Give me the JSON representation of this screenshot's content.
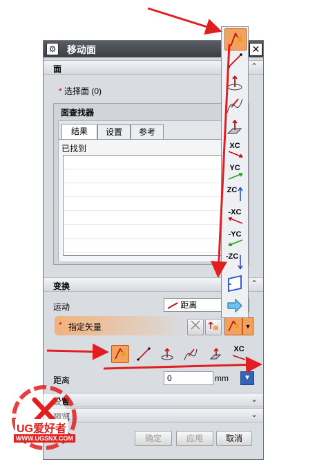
{
  "dialog": {
    "title": "移动面",
    "close_glyph": "✕",
    "face_section": {
      "header": "面",
      "select_label": "选择面 (0)",
      "required_mark": "*"
    },
    "face_finder": {
      "header": "面查找器",
      "tabs": [
        "结果",
        "设置",
        "参考"
      ],
      "found_label": "已找到"
    },
    "transform_section": {
      "header": "变换",
      "motion_label": "运动",
      "motion_value": "距离",
      "vector_label": "指定矢量",
      "distance_label": "距离",
      "distance_value": "0",
      "distance_unit": "mm",
      "vector_toolbar": [
        {
          "icon": "auto-vector-icon",
          "label": ""
        },
        {
          "icon": "two-points-icon",
          "label": ""
        },
        {
          "icon": "angle-vector-icon",
          "label": ""
        },
        {
          "icon": "curve-tangent-icon",
          "label": ""
        },
        {
          "icon": "face-normal-icon",
          "label": ""
        },
        {
          "icon": "xc-axis-icon",
          "label": "XC"
        }
      ]
    },
    "settings_header": "设置",
    "preview_header": "预览",
    "buttons": {
      "ok": "确定",
      "apply": "应用",
      "cancel": "取消"
    }
  },
  "vector_palette": {
    "items": [
      {
        "icon": "auto-vector-icon",
        "label": ""
      },
      {
        "icon": "two-points-icon",
        "label": ""
      },
      {
        "icon": "angle-vector-icon",
        "label": ""
      },
      {
        "icon": "curve-tangent-icon",
        "label": ""
      },
      {
        "icon": "face-normal-icon",
        "label": ""
      },
      {
        "icon": "xc-axis-icon",
        "label": "XC"
      },
      {
        "icon": "yc-axis-icon",
        "label": "YC"
      },
      {
        "icon": "zc-axis-icon",
        "label": "ZC"
      },
      {
        "icon": "neg-xc-axis-icon",
        "label": "-XC"
      },
      {
        "icon": "neg-yc-axis-icon",
        "label": "-YC"
      },
      {
        "icon": "neg-zc-axis-icon",
        "label": "-ZC"
      },
      {
        "icon": "plane-normal-icon",
        "label": ""
      },
      {
        "icon": "vector-arrow-icon",
        "label": ""
      }
    ]
  },
  "watermark": {
    "brand": "UG爱好者",
    "url": "WWW.UGSNX.COM"
  },
  "colors": {
    "accent": "#f4a15e",
    "annotation_arrow": "#e02020",
    "titlebar": "#3b3e44"
  }
}
